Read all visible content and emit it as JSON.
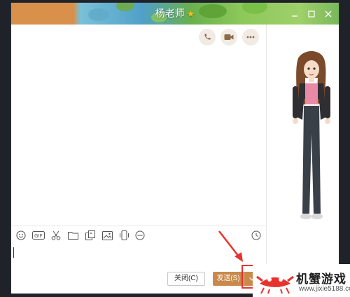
{
  "window": {
    "title": "杨老师",
    "title_badge": "★",
    "controls": [
      "minimize-icon",
      "maximize-icon",
      "close-icon"
    ]
  },
  "header_actions": [
    "phone-icon",
    "video-icon",
    "more-icon"
  ],
  "toolbar": {
    "tools": [
      "emoji-icon",
      "gif-icon",
      "scissors-icon",
      "folder-icon",
      "image-edit-icon",
      "picture-icon",
      "phone-vibrate-icon",
      "more-circle-icon"
    ],
    "history_icon": "clock-icon"
  },
  "footer": {
    "close_label": "关闭(C)",
    "send_label": "发送(S)",
    "dropdown_icon": "chevron-down-icon"
  },
  "watermark": {
    "name": "机蟹游戏",
    "url": "www.jixie5188.com"
  },
  "colors": {
    "accent": "#c98a4b",
    "highlight": "#e8322e",
    "star": "#f6c21c"
  }
}
